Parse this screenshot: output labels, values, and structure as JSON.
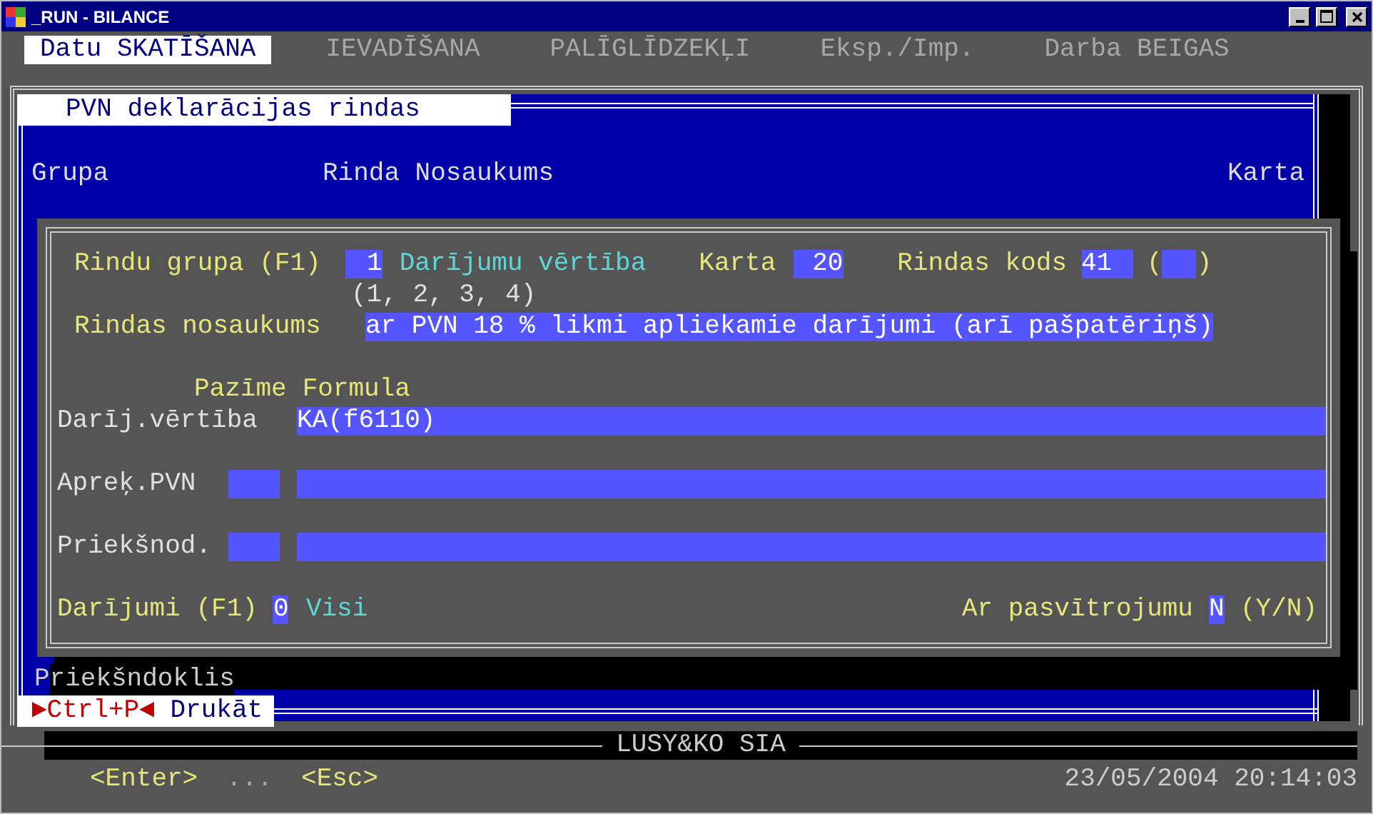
{
  "window": {
    "title": "_RUN - BILANCE"
  },
  "menu": [
    {
      "label": "Datu SKATĪŠANA",
      "selected": true
    },
    {
      "label": "IEVADĪŠANA",
      "selected": false
    },
    {
      "label": "PALĪGLĪDZEKĻI",
      "selected": false
    },
    {
      "label": "Eksp./Imp.",
      "selected": false
    },
    {
      "label": "Darba BEIGAS",
      "selected": false
    }
  ],
  "panel": {
    "title": "PVN deklarācijas rindas",
    "columns": [
      "Grupa",
      "Rinda Nosaukums",
      "Karta"
    ],
    "prefix_row": "Priekšndoklis",
    "print_key": "►Ctrl+P◄",
    "print_label": "Drukāt"
  },
  "dialog": {
    "group": {
      "label": "Rindu grupa (F1)",
      "value": "1",
      "name": "Darījumu vērtība",
      "hint": "(1, 2, 3, 4)"
    },
    "card": {
      "label": "Karta",
      "value": "20"
    },
    "code": {
      "label": "Rindas kods",
      "value": "41",
      "open": "(",
      "close": ")"
    },
    "row_name": {
      "label": "Rindas nosaukums",
      "value": "ar PVN 18 % likmi apliekamie darījumi (arī pašpatēriņš)"
    },
    "column_headers": [
      "Pazīme",
      "Formula"
    ],
    "formulas": [
      {
        "kind": "formula",
        "label": "Darīj.vērtība",
        "formula": "KA(f6110)"
      },
      {
        "kind": "flagged",
        "label": "Apreķ.PVN"
      },
      {
        "kind": "flagged",
        "label": "Priekšnod."
      }
    ],
    "transactions": {
      "label": "Darījumi (F1)",
      "value": "0",
      "name": "Visi"
    },
    "underline": {
      "label": "Ar pasvītrojumu",
      "value": "N",
      "hint": "(Y/N)"
    }
  },
  "footer": {
    "company": "LUSY&KO SIA",
    "keys": [
      "<Enter>",
      "...",
      "<Esc>"
    ],
    "datetime": "23/05/2004 20:14:03"
  }
}
